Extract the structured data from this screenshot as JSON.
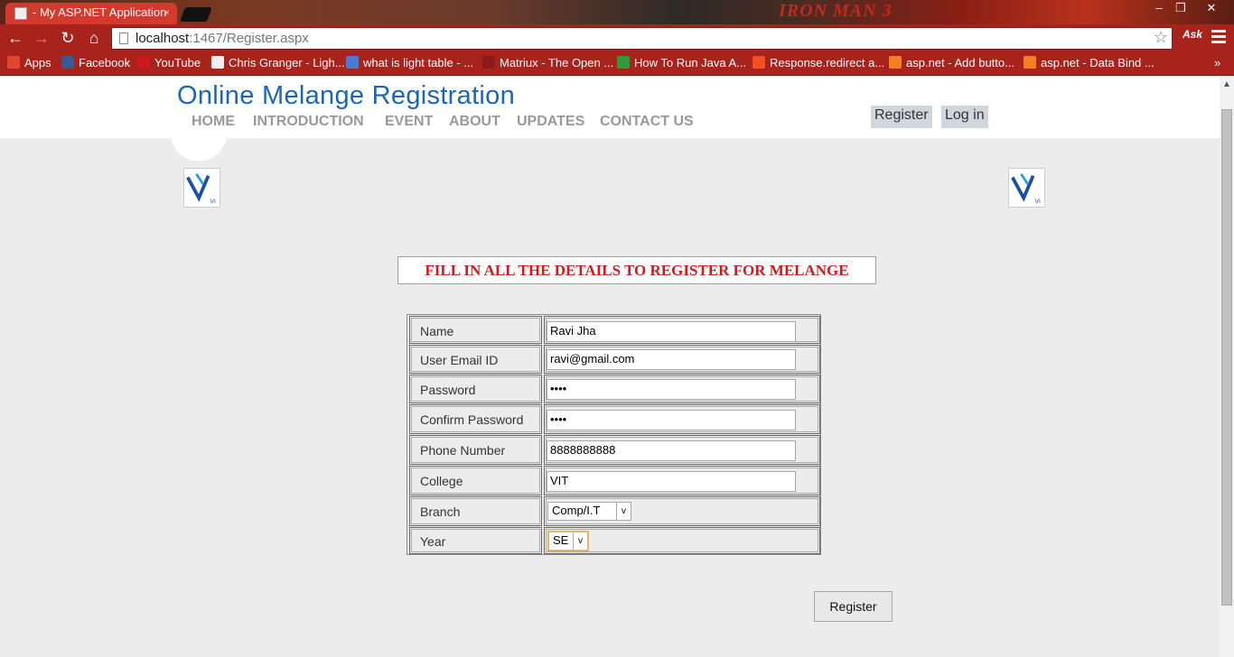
{
  "browser": {
    "tab_title": " - My ASP.NET Application",
    "tab_close": "×",
    "theme_text": "IRON MAN 3",
    "url_host": "localhost",
    "url_path": ":1467/Register.aspx",
    "ask_label": "Ask",
    "window_minimize": "‒",
    "window_restore": "❐",
    "window_close": "✕",
    "back": "←",
    "forward": "→",
    "reload": "↻",
    "home": "⌂",
    "star": "☆"
  },
  "bookmarks": [
    {
      "label": "Apps",
      "icon": "apps-grid-icon",
      "color": "#e2462f"
    },
    {
      "label": "Facebook",
      "icon": "facebook-icon",
      "color": "#3b5998"
    },
    {
      "label": "YouTube",
      "icon": "youtube-icon",
      "color": "#cc181e"
    },
    {
      "label": "Chris Granger - Ligh...",
      "icon": "page-icon",
      "color": "#eeeeee"
    },
    {
      "label": "what is light table - ...",
      "icon": "google-icon",
      "color": "#4a7bd6"
    },
    {
      "label": "Matriux - The Open ...",
      "icon": "matriux-icon",
      "color": "#8b1a1a"
    },
    {
      "label": "How To Run Java A...",
      "icon": "download-icon",
      "color": "#2e9b3a"
    },
    {
      "label": "Response.redirect a...",
      "icon": "microsoft-icon",
      "color": "#f25022"
    },
    {
      "label": "asp.net - Add butto...",
      "icon": "stackoverflow-icon",
      "color": "#f48024"
    },
    {
      "label": "asp.net - Data Bind ...",
      "icon": "stackoverflow-icon",
      "color": "#f48024"
    }
  ],
  "bookmarks_overflow": "»",
  "site": {
    "title": "Online Melange Registration",
    "nav": [
      "HOME",
      "INTRODUCTION",
      "EVENT",
      "ABOUT",
      "UPDATES",
      "CONTACT US"
    ],
    "register_link": "Register",
    "login_link": "Log in",
    "logo_mark": "VI"
  },
  "headline": "FILL IN ALL THE DETAILS TO REGISTER FOR MELANGE",
  "form": {
    "name_label": "Name",
    "name_value": "Ravi Jha",
    "email_label": "User Email ID",
    "email_value": "ravi@gmail.com",
    "password_label": "Password",
    "password_value": "••••",
    "confirm_label": "Confirm Password",
    "confirm_value": "••••",
    "phone_label": "Phone Number",
    "phone_value": "8888888888",
    "college_label": "College",
    "college_value": "VIT",
    "branch_label": "Branch",
    "branch_value": "Comp/I.T",
    "year_label": "Year",
    "year_value": "SE",
    "select_arrow": "v",
    "submit_label": "Register"
  },
  "scroll_up": "▲"
}
